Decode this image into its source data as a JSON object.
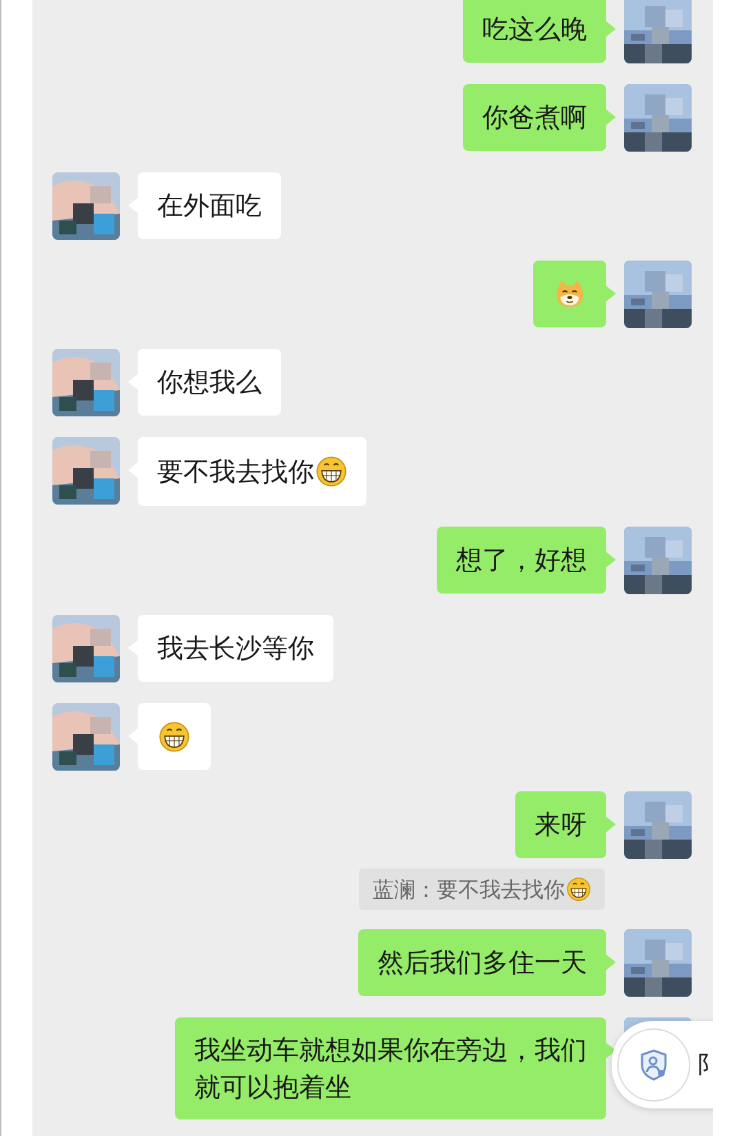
{
  "messages": [
    {
      "outgoing": true,
      "kind": "text",
      "lines": [
        "吃这么晚"
      ]
    },
    {
      "outgoing": true,
      "kind": "text",
      "lines": [
        "你爸煮啊"
      ]
    },
    {
      "outgoing": false,
      "kind": "text",
      "lines": [
        "在外面吃"
      ]
    },
    {
      "outgoing": true,
      "kind": "sticker"
    },
    {
      "outgoing": false,
      "kind": "text",
      "lines": [
        "你想我么"
      ]
    },
    {
      "outgoing": false,
      "kind": "text",
      "lines": [
        "要不我去找你"
      ],
      "trailing_emoji": true
    },
    {
      "outgoing": true,
      "kind": "text",
      "lines": [
        "想了，好想"
      ]
    },
    {
      "outgoing": false,
      "kind": "text",
      "lines": [
        "我去长沙等你"
      ]
    },
    {
      "outgoing": false,
      "kind": "emoji"
    },
    {
      "outgoing": true,
      "kind": "text",
      "lines": [
        "来呀"
      ]
    },
    {
      "outgoing": true,
      "kind": "quote",
      "lines": [
        "蓝澜：要不我去找你"
      ],
      "trailing_emoji": true
    },
    {
      "outgoing": true,
      "kind": "text",
      "lines": [
        "然后我们多住一天"
      ]
    },
    {
      "outgoing": true,
      "kind": "text",
      "lines": [
        "我坐动车就想如果你在旁边，我们",
        "就可以抱着坐"
      ]
    }
  ],
  "floating_panel": {
    "text": "阝"
  }
}
